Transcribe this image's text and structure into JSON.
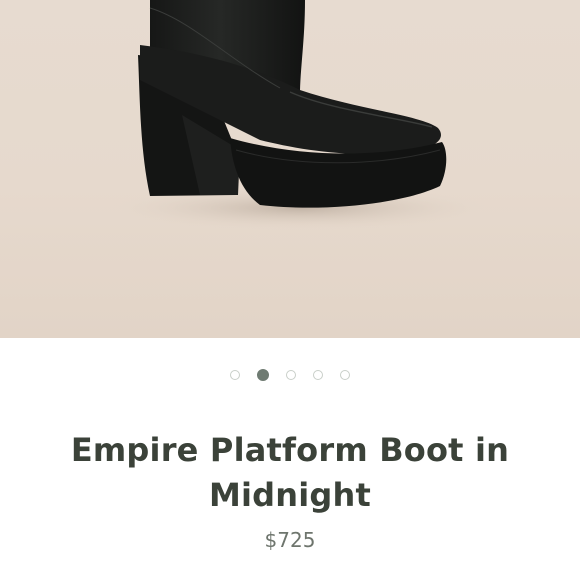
{
  "product": {
    "image_alt": "black platform boot",
    "title": "Empire Platform Boot in Midnight",
    "price": "$725"
  },
  "carousel": {
    "count": 5,
    "active_index": 1
  },
  "colors": {
    "title": "#3b4239",
    "price": "#6e756d",
    "dot_active": "#6f7b72",
    "dot_inactive": "#c9cfc9"
  }
}
